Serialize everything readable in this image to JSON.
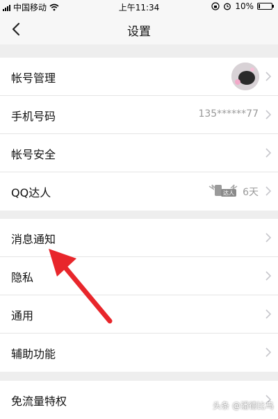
{
  "status_bar": {
    "carrier": "中国移动",
    "time": "上午11:34",
    "battery_text": "10%",
    "battery_level": 0.1
  },
  "nav": {
    "title": "设置"
  },
  "groups": [
    {
      "items": [
        {
          "label": "帐号管理",
          "value": ""
        },
        {
          "label": "手机号码",
          "value": "135******77"
        },
        {
          "label": "帐号安全",
          "value": ""
        },
        {
          "label": "QQ达人",
          "value": "6天",
          "badge_text": "达人"
        }
      ]
    },
    {
      "items": [
        {
          "label": "消息通知"
        },
        {
          "label": "隐私"
        },
        {
          "label": "通用"
        },
        {
          "label": "辅助功能"
        }
      ]
    },
    {
      "items": [
        {
          "label": "免流量特权"
        }
      ]
    }
  ],
  "watermark": "头条 @潘德比乌",
  "colors": {
    "accent_arrow": "#e8262b",
    "background": "#eeeeee",
    "secondary_text": "#999999"
  }
}
